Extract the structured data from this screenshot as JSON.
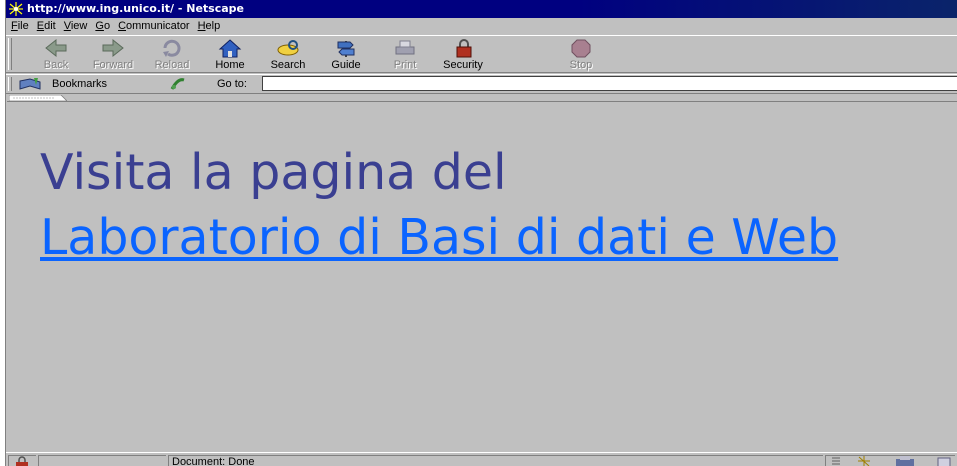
{
  "window": {
    "title": "http://www.ing.unico.it/ - Netscape"
  },
  "menu": {
    "items": [
      {
        "label": "File",
        "accel": "F",
        "rest": "ile"
      },
      {
        "label": "Edit",
        "accel": "E",
        "rest": "dit"
      },
      {
        "label": "View",
        "accel": "V",
        "rest": "iew"
      },
      {
        "label": "Go",
        "accel": "G",
        "rest": "o"
      },
      {
        "label": "Communicator",
        "accel": "C",
        "rest": "ommunicator"
      },
      {
        "label": "Help",
        "accel": "H",
        "rest": "elp"
      }
    ]
  },
  "toolbar": {
    "back": "Back",
    "forward": "Forward",
    "reload": "Reload",
    "home": "Home",
    "search": "Search",
    "guide": "Guide",
    "print": "Print",
    "security": "Security",
    "stop": "Stop"
  },
  "location": {
    "bookmarks_label": "Bookmarks",
    "goto_label": "Go to:",
    "url_value": ""
  },
  "content": {
    "headline": "Visita la pagina del",
    "link_text": "Laboratorio di Basi di dati e Web"
  },
  "status": {
    "text": "Document: Done"
  },
  "colors": {
    "title_bg": "#000080",
    "chrome": "#c0c0c0",
    "headline": "#3a3f91",
    "link": "#0a64ff"
  }
}
